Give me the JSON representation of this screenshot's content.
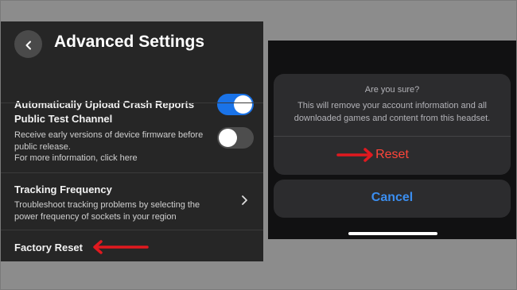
{
  "settings": {
    "title": "Advanced Settings",
    "rows": [
      {
        "title": "Automatically Upload Crash Reports",
        "toggle_on": true
      },
      {
        "title": "Public Test Channel",
        "description": "Receive early versions of device firmware before public release.",
        "more_info": "For more information, click here",
        "toggle_on": false
      },
      {
        "title": "Tracking Frequency",
        "description": "Troubleshoot tracking problems by selecting the power frequency of sockets in your region"
      },
      {
        "title": "Factory Reset"
      }
    ]
  },
  "dialog": {
    "title": "Are you sure?",
    "message": "This will remove your account information and all downloaded games and content from this headset.",
    "confirm_label": "Reset",
    "cancel_label": "Cancel"
  },
  "colors": {
    "annotation_arrow": "#e0191f",
    "toggle_on": "#1a73e8",
    "reset_text": "#ff453a",
    "cancel_text": "#3b8ef0"
  },
  "icons": {
    "back": "chevron-left-icon",
    "row_nav": "chevron-right-icon",
    "annotation": "red-arrow-icon"
  }
}
